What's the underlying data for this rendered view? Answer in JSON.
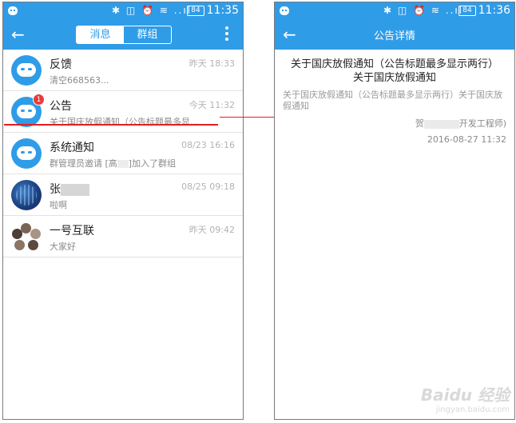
{
  "status_bar": {
    "battery": "84",
    "left_time": "11:35",
    "right_time": "11:36",
    "icons": "✱ ◫ ⏰ ≋ ..ıl"
  },
  "left_screen": {
    "tabs": [
      {
        "label": "消息",
        "selected": true
      },
      {
        "label": "群组",
        "selected": false
      }
    ],
    "conversations": [
      {
        "name": "反馈",
        "time": "昨天 18:33",
        "preview": "清空668563..."
      },
      {
        "name": "公告",
        "time": "今天 11:32",
        "preview": "关于国庆放假通知（公告标题最多显...",
        "badge": "1"
      },
      {
        "name": "系统通知",
        "time": "08/23 16:16",
        "preview_prefix": "群管理员邀请 [高",
        "preview_suffix": "]加入了群组"
      },
      {
        "name": "张",
        "time": "08/25 09:18",
        "preview": "啦啊"
      },
      {
        "name": "一号互联",
        "time": "昨天 09:42",
        "preview": "大家好"
      }
    ]
  },
  "right_screen": {
    "title": "公告详情",
    "notice_title": "关于国庆放假通知（公告标题最多显示两行）关于国庆放假通知",
    "notice_body": "关于国庆放假通知（公告标题最多显示两行）关于国庆放假通知",
    "author_prefix": "贺",
    "author_suffix": "开发工程师)",
    "date": "2016-08-27 11:32"
  },
  "watermark": {
    "logo": "Baidu 经验",
    "url": "jingyan.baidu.com"
  },
  "colors": {
    "accent": "#2f9ce8",
    "annotation": "#e02020",
    "badge": "#e83a3a"
  }
}
